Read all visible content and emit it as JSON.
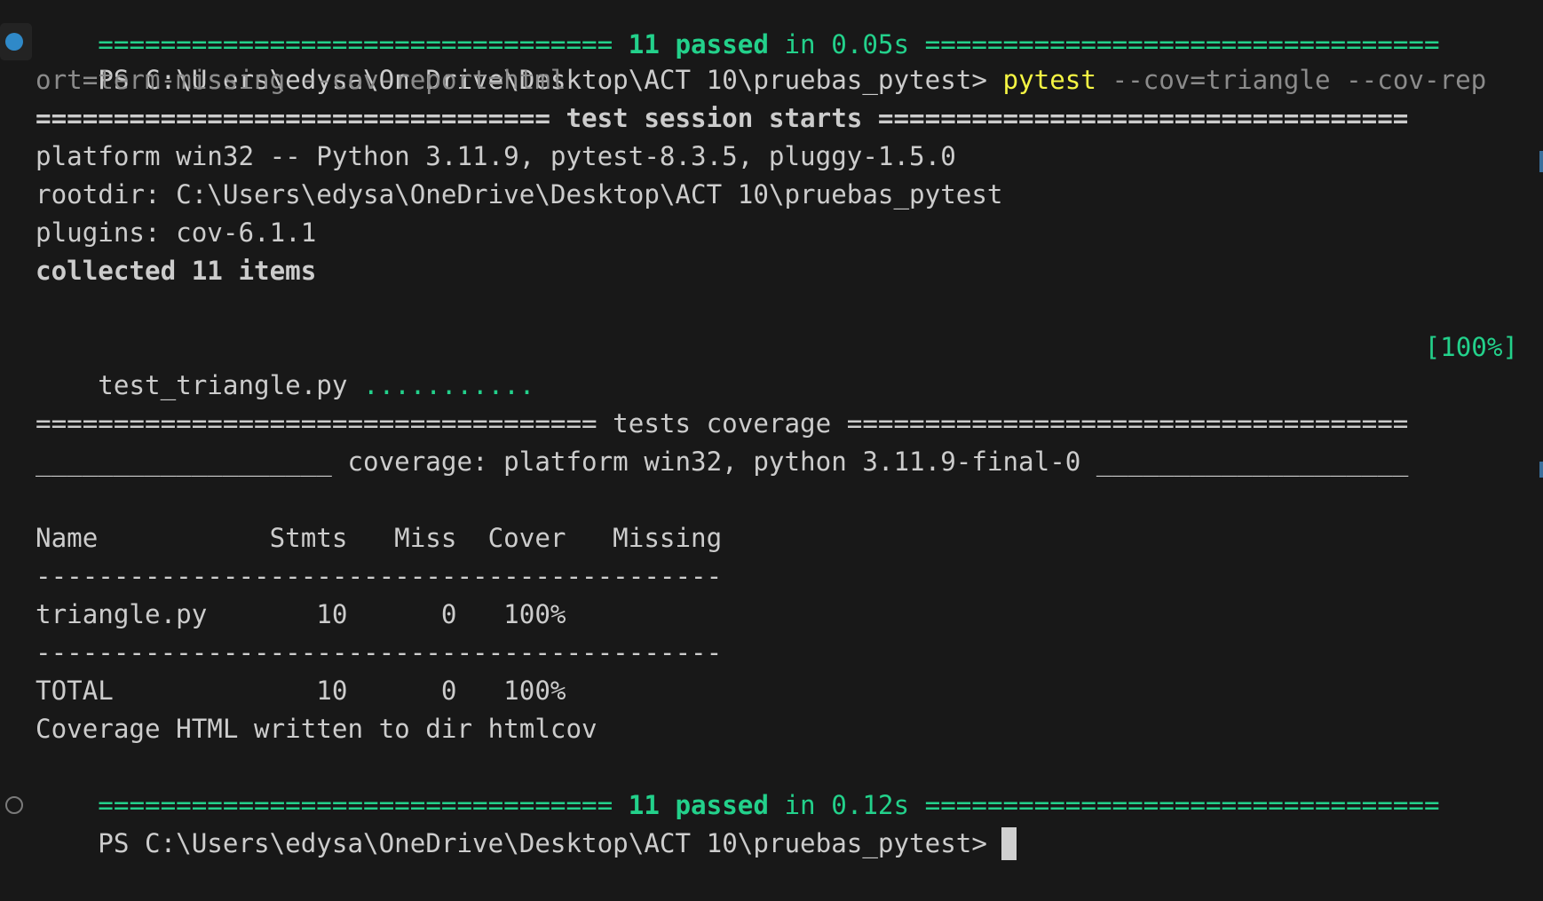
{
  "top_summary": {
    "left_rule": "=================================",
    "passed_text": " 11 passed ",
    "time_text": "in 0.05s",
    "right_rule": " ================================="
  },
  "prompt": {
    "path": "PS C:\\Users\\edysa\\OneDrive\\Desktop\\ACT 10\\pruebas_pytest>",
    "command": "pytest",
    "args_line1": "--cov=triangle --cov-rep",
    "args_line2": "ort=term-missing --cov-report=html"
  },
  "session_header": "================================= test session starts ==================================",
  "session_info": {
    "platform": "platform win32 -- Python 3.11.9, pytest-8.3.5, pluggy-1.5.0",
    "rootdir": "rootdir: C:\\Users\\edysa\\OneDrive\\Desktop\\ACT 10\\pruebas_pytest",
    "plugins": "plugins: cov-6.1.1",
    "collected": "collected 11 items"
  },
  "test_result": {
    "file": "test_triangle.py",
    "dots": "...........",
    "percent": "[100%]"
  },
  "coverage_header": "==================================== tests coverage ====================================",
  "coverage_subheader": "___________________ coverage: platform win32, python 3.11.9-final-0 ____________________",
  "coverage_table": {
    "header": "Name           Stmts   Miss  Cover   Missing",
    "divider": "--------------------------------------------",
    "rows": [
      "triangle.py       10      0   100%"
    ],
    "total": "TOTAL             10      0   100%"
  },
  "coverage_html": "Coverage HTML written to dir htmlcov",
  "final_summary": {
    "left_rule": "=================================",
    "passed_text": " 11 passed ",
    "time_text": "in 0.12s",
    "right_rule": " ================================="
  },
  "final_prompt": "PS C:\\Users\\edysa\\OneDrive\\Desktop\\ACT 10\\pruebas_pytest>",
  "colors": {
    "background": "#181818",
    "foreground": "#cccccc",
    "green": "#23d18b",
    "yellow": "#f5f543",
    "gray": "#8b8b8b",
    "decoration_blue": "#2f89c8"
  }
}
